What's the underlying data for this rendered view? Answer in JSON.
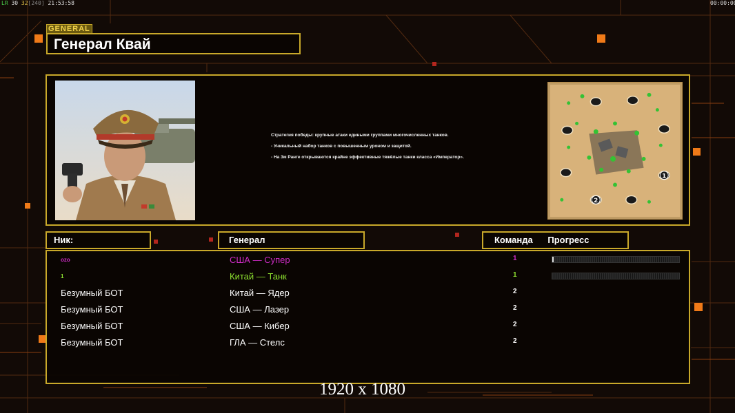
{
  "hud": {
    "left_status_parts": [
      "LR",
      " 30 ",
      "32",
      "[240]",
      " 21:53:58"
    ],
    "right_timer": "00:00:00"
  },
  "general": {
    "tag": "GENERAL",
    "name": "Генерал Квай",
    "description": [
      "Стратегия победы: крупные атаки едиными группами многочисленных танков.",
      "- Уникальный набор танков с повышенным уроном и защитой.",
      "- На 3м Ранге открываются крайне эффективные тяжёлые танки класса «Император»."
    ]
  },
  "table": {
    "headers": {
      "nick": "Ник:",
      "general": "Генерал",
      "team": "Команда",
      "progress": "Прогресс"
    },
    "rows": [
      {
        "nick": "ozo",
        "general": "США — Супер",
        "team": "1",
        "color": "#d02cc8",
        "progress": 0.01,
        "show_progress": true,
        "small_nick": true
      },
      {
        "nick": "1",
        "general": "Китай — Танк",
        "team": "1",
        "color": "#8de030",
        "progress": 0.0,
        "show_progress": true,
        "small_nick": true
      },
      {
        "nick": "Безумный БОТ",
        "general": "Китай — Ядер",
        "team": "2",
        "color": "#ffffff",
        "show_progress": false
      },
      {
        "nick": "Безумный БОТ",
        "general": "США — Лазер",
        "team": "2",
        "color": "#ffffff",
        "show_progress": false
      },
      {
        "nick": "Безумный БОТ",
        "general": "США — Кибер",
        "team": "2",
        "color": "#ffffff",
        "show_progress": false
      },
      {
        "nick": "Безумный БОТ",
        "general": "ГЛА — Стелс",
        "team": "2",
        "color": "#ffffff",
        "show_progress": false
      }
    ]
  },
  "minimap": {
    "start_labels": [
      "1",
      "2"
    ]
  },
  "overlay": {
    "resolution": "1920 x 1080"
  },
  "colors": {
    "accent_gold": "#c9a92a",
    "accent_orange": "#f07a18",
    "background": "#120a06"
  }
}
